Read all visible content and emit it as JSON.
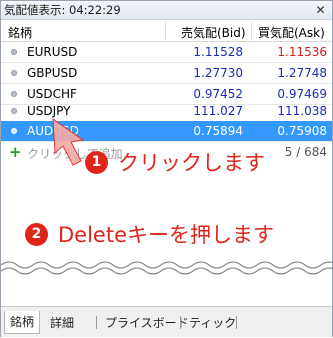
{
  "window": {
    "title": "気配値表示: 04:22:29",
    "close_icon": "close-icon"
  },
  "columns": {
    "symbol": "銘柄",
    "bid": "売気配(Bid)",
    "ask": "買気配(Ask)"
  },
  "rows": [
    {
      "symbol": "EURUSD",
      "bid": "1.11528",
      "ask": "1.11536",
      "ask_color": "red",
      "selected": false
    },
    {
      "symbol": "GBPUSD",
      "bid": "1.27730",
      "ask": "1.27748",
      "ask_color": "blue",
      "selected": false
    },
    {
      "symbol": "USDCHF",
      "bid": "0.97452",
      "ask": "0.97469",
      "ask_color": "blue",
      "selected": false
    },
    {
      "symbol": "USDJPY",
      "bid": "111.027",
      "ask": "111.038",
      "ask_color": "blue",
      "selected": false
    },
    {
      "symbol": "AUDUSD",
      "bid": "0.75894",
      "ask": "0.75908",
      "ask_color": "blue",
      "selected": true
    }
  ],
  "add_row": {
    "label": "クリックして追加...",
    "count": "5 / 684"
  },
  "steps": [
    {
      "number": "1",
      "text": "クリックします"
    },
    {
      "number": "2",
      "text": "Deleteキーを押します"
    }
  ],
  "tabs": [
    {
      "label": "銘柄",
      "active": true
    },
    {
      "label": "詳細",
      "active": false
    },
    {
      "label": "プライスボード",
      "active": false
    },
    {
      "label": "ティック",
      "active": false
    }
  ],
  "colors": {
    "accent_red": "#e0251b",
    "selection": "#3399ff",
    "price_blue": "#1a2eb8",
    "price_red": "#d51d1d"
  }
}
